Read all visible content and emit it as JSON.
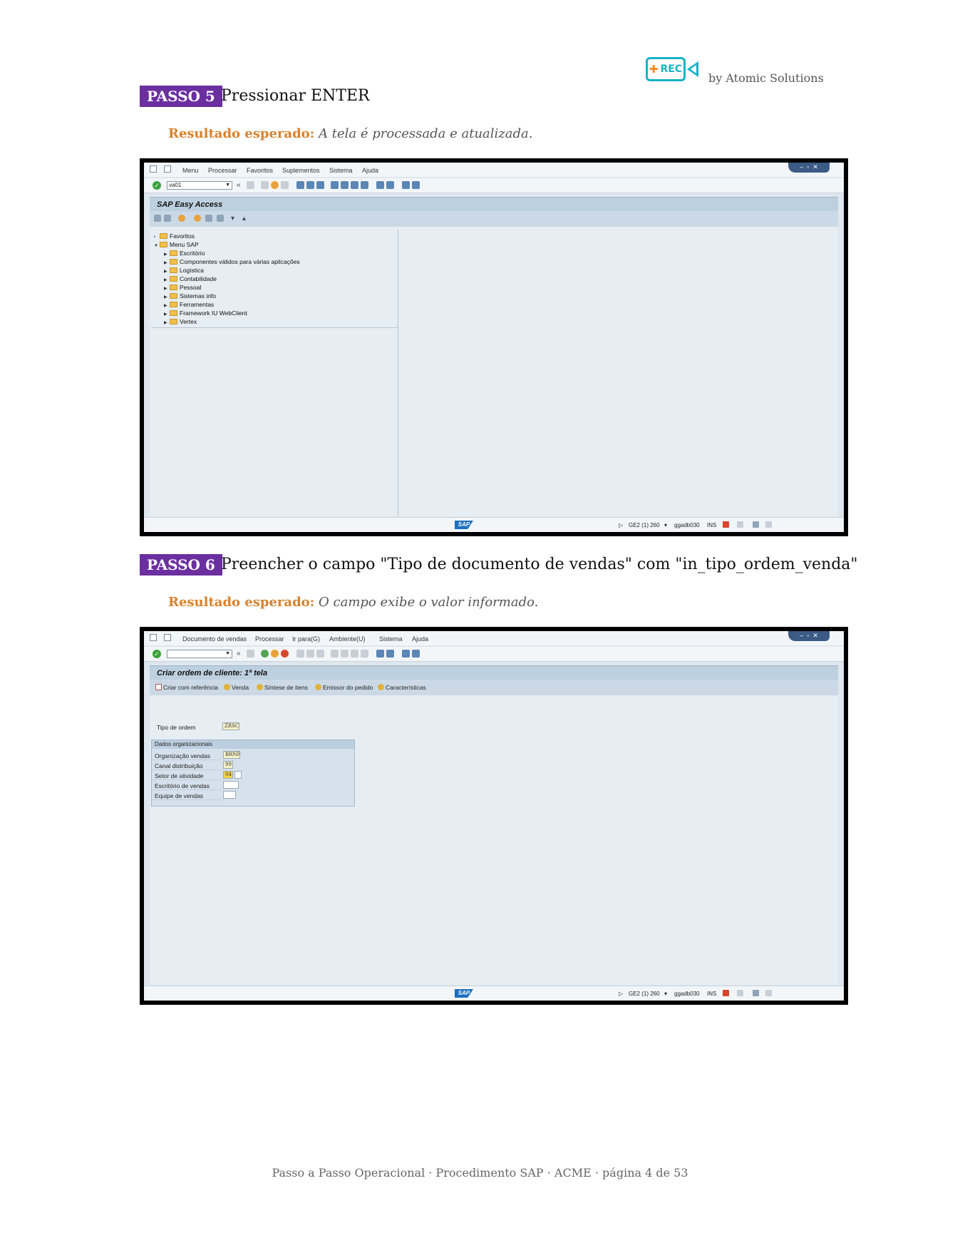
{
  "header": {
    "logo_text": "REC",
    "byline": "by Atomic Solutions"
  },
  "steps": [
    {
      "badge": "PASSO 5",
      "title": "Pressionar ENTER",
      "result_label": "Resultado esperado:",
      "result_text": "A tela é processada e atualizada.",
      "screen": {
        "menu": [
          "Menu",
          "Processar",
          "Favoritos",
          "Suplementos",
          "Sistema",
          "Ajuda"
        ],
        "ok_code": "va01",
        "title": "SAP Easy Access",
        "tree": [
          {
            "label": "Favoritos",
            "level": 0,
            "expanded": false
          },
          {
            "label": "Menu SAP",
            "level": 0,
            "expanded": true
          },
          {
            "label": "Escritório",
            "level": 1,
            "expanded": false
          },
          {
            "label": "Componentes válidos para várias aplicações",
            "level": 1,
            "expanded": false
          },
          {
            "label": "Logística",
            "level": 1,
            "expanded": false
          },
          {
            "label": "Contabilidade",
            "level": 1,
            "expanded": false
          },
          {
            "label": "Pessoal",
            "level": 1,
            "expanded": false
          },
          {
            "label": "Sistemas info",
            "level": 1,
            "expanded": false
          },
          {
            "label": "Ferramentas",
            "level": 1,
            "expanded": false
          },
          {
            "label": "Framework IU WebClient",
            "level": 1,
            "expanded": false
          },
          {
            "label": "Vertex",
            "level": 1,
            "expanded": false
          }
        ],
        "status": {
          "system": "GE2 (1) 260",
          "user": "ggadb030",
          "mode": "INS",
          "logo": "SAP"
        }
      }
    },
    {
      "badge": "PASSO 6",
      "title": "Preencher o campo \"Tipo de documento de vendas\" com \"in_tipo_ordem_venda\"",
      "result_label": "Resultado esperado:",
      "result_text": "O campo exibe o valor informado.",
      "screen": {
        "menu": [
          "Documento de vendas",
          "Processar",
          "Ir para(G)",
          "Ambiente(U)",
          "Sistema",
          "Ajuda"
        ],
        "ok_code": "",
        "title": "Criar ordem de cliente: 1ª tela",
        "app_toolbar": [
          "Criar com referência",
          "Venda",
          "Síntese de itens",
          "Emissor do pedido",
          "Características"
        ],
        "order_type_label": "Tipo de ordem",
        "order_type_value": "ZRSC",
        "org_group_title": "Dados organizacionais",
        "org_fields": [
          {
            "label": "Organização vendas",
            "value": "BRNF"
          },
          {
            "label": "Canal distribuição",
            "value": "99"
          },
          {
            "label": "Setor de atividade",
            "value": "04"
          },
          {
            "label": "Escritório de vendas",
            "value": ""
          },
          {
            "label": "Equipe de vendas",
            "value": ""
          }
        ],
        "status": {
          "system": "GE2 (1) 260",
          "user": "ggadb030",
          "mode": "INS",
          "logo": "SAP"
        }
      }
    }
  ],
  "footer": "Passo a Passo Operacional · Procedimento SAP · ACME · página 4 de 53"
}
